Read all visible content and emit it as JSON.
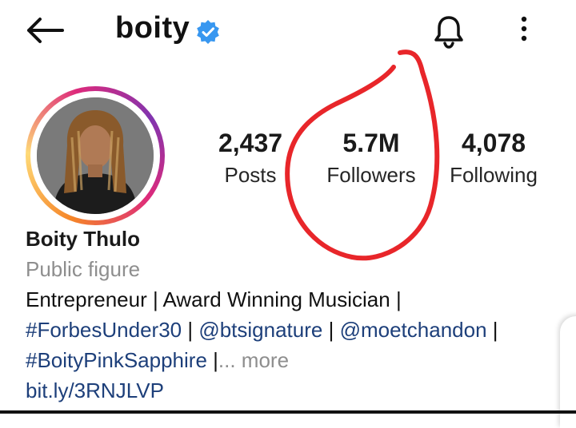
{
  "header": {
    "username": "boity",
    "verified": true,
    "icons": [
      "back-arrow-icon",
      "verified-badge-icon",
      "bell-icon",
      "more-vertical-icon"
    ]
  },
  "profile": {
    "stats": [
      {
        "value": "2,437",
        "label": "Posts"
      },
      {
        "value": "5.7M",
        "label": "Followers"
      },
      {
        "value": "4,078",
        "label": "Following"
      }
    ],
    "name": "Boity Thulo",
    "category": "Public figure",
    "bio": {
      "line1": "Entrepreneur | Award Winning Musician |",
      "line2_tag1": "#ForbesUnder30",
      "line2_sep1": " | ",
      "line2_tag2": "@btsignature",
      "line2_sep2": " | ",
      "line2_tag3": "@moetchandon",
      "line2_sep3": " |",
      "line3_tag": "#BoityPinkSapphire",
      "line3_sep": " |",
      "line3_more": "... more",
      "link": "bit.ly/3RNJLVP"
    }
  },
  "colors": {
    "annotation": "#e8262a",
    "verified": "#3897f0",
    "link": "#1d3f7a",
    "muted": "#8e8e8e"
  }
}
